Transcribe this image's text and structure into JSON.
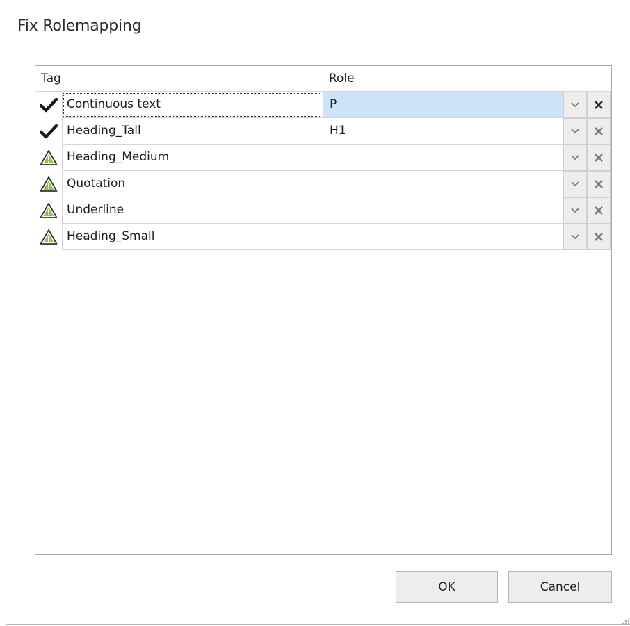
{
  "dialog": {
    "title": "Fix Rolemapping",
    "columns": {
      "tag": "Tag",
      "role": "Role"
    },
    "rows": [
      {
        "status": "ok",
        "status_icon": "checkmark-icon",
        "tag": "Continuous text",
        "role": "P",
        "selected": true
      },
      {
        "status": "ok",
        "status_icon": "checkmark-icon",
        "tag": "Heading_Tall",
        "role": "H1",
        "selected": false
      },
      {
        "status": "warning",
        "status_icon": "warning-icon",
        "tag": "Heading_Medium",
        "role": "",
        "selected": false
      },
      {
        "status": "warning",
        "status_icon": "warning-icon",
        "tag": "Quotation",
        "role": "",
        "selected": false
      },
      {
        "status": "warning",
        "status_icon": "warning-icon",
        "tag": "Underline",
        "role": "",
        "selected": false
      },
      {
        "status": "warning",
        "status_icon": "warning-icon",
        "tag": "Heading_Small",
        "role": "",
        "selected": false
      }
    ],
    "buttons": {
      "ok": "OK",
      "cancel": "Cancel"
    },
    "icons": {
      "dropdown": "chevron-down-icon",
      "clear": "close-icon",
      "resize": "resize-grip-icon"
    },
    "colors": {
      "accent": "#2b8fd4",
      "selection": "#cde3f7",
      "warning_fill": "#8dc63f",
      "button_face": "#ededed"
    }
  }
}
